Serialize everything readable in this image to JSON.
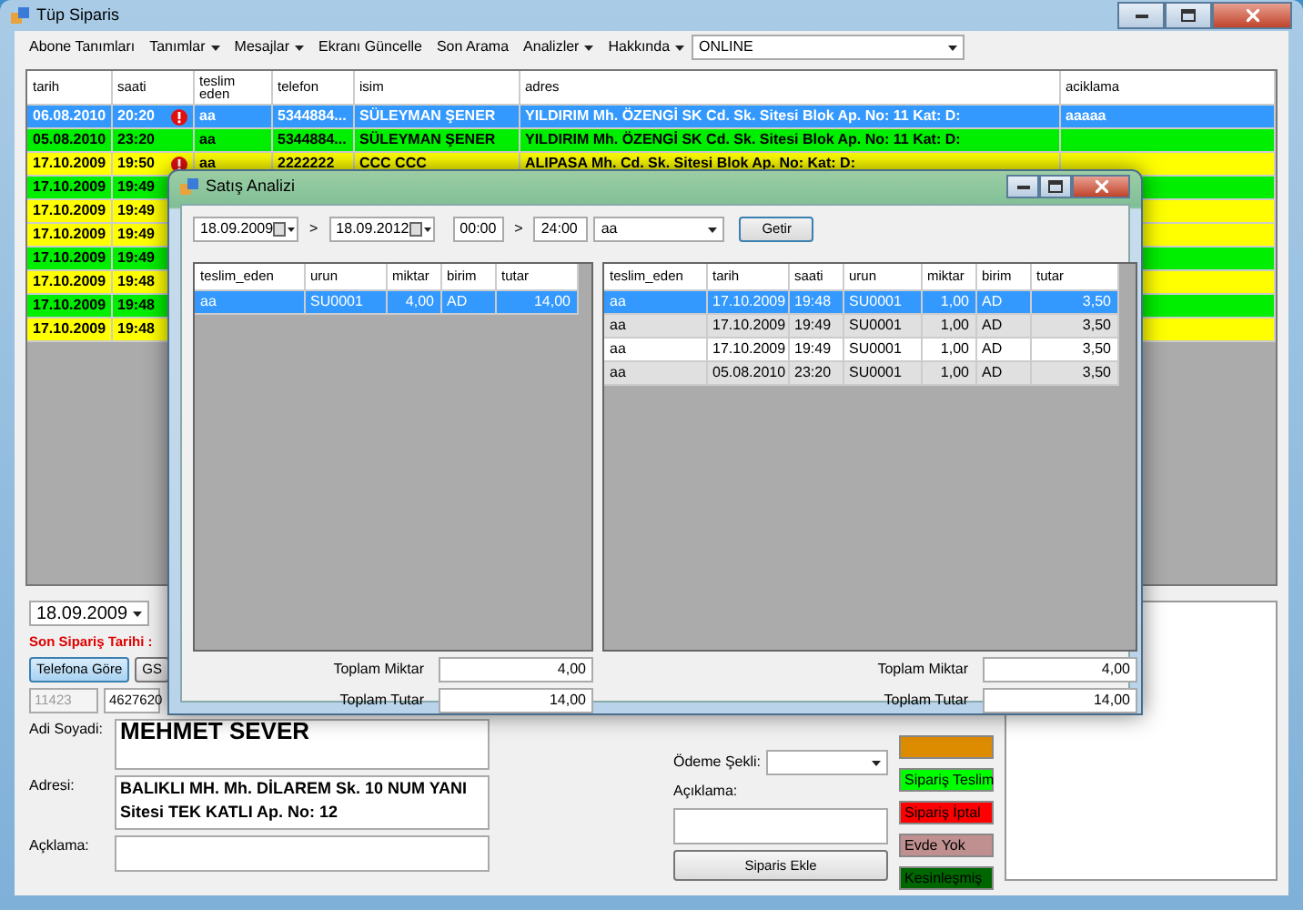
{
  "window": {
    "title": "Tüp Siparis"
  },
  "menu": [
    {
      "label": "Abone Tanımları",
      "dropdown": false
    },
    {
      "label": "Tanımlar",
      "dropdown": true
    },
    {
      "label": "Mesajlar",
      "dropdown": true
    },
    {
      "label": "Ekranı Güncelle",
      "dropdown": false
    },
    {
      "label": "Son Arama",
      "dropdown": false
    },
    {
      "label": "Analizler",
      "dropdown": true
    },
    {
      "label": "Hakkında",
      "dropdown": true
    }
  ],
  "status_combo": {
    "value": "ONLINE"
  },
  "orders": {
    "columns": [
      "tarih",
      "saati",
      "teslim eden",
      "telefon",
      "isim",
      "adres",
      "aciklama"
    ],
    "rows": [
      {
        "tarih": "06.08.2010",
        "saati": "20:20",
        "alert": true,
        "teslim_eden": "aa",
        "telefon": "5344884...",
        "isim": "SÜLEYMAN ŞENER",
        "adres": "YILDIRIM Mh. ÖZENGİ SK Cd.  Sk.  Sitesi  Blok  Ap. No: 11 Kat:  D:",
        "aciklama": "aaaaa",
        "selected": true
      },
      {
        "tarih": "05.08.2010",
        "saati": "23:20",
        "alert": false,
        "teslim_eden": "aa",
        "telefon": "5344884...",
        "isim": "SÜLEYMAN ŞENER",
        "adres": "YILDIRIM Mh. ÖZENGİ SK Cd.  Sk.  Sitesi  Blok  Ap. No: 11 Kat:  D:",
        "color": "#00ee00",
        "selected": false
      },
      {
        "tarih": "17.10.2009",
        "saati": "19:50",
        "alert": true,
        "teslim_eden": "aa",
        "telefon": "2222222",
        "isim": "CCC CCC",
        "adres": "ALIPASA Mh.  Cd.  Sk.  Sitesi  Blok  Ap. No:  Kat:  D:",
        "color": "#ffff00",
        "selected": false
      },
      {
        "tarih": "17.10.2009",
        "saati": "19:49",
        "color": "#00ee00",
        "selected": false
      },
      {
        "tarih": "17.10.2009",
        "saati": "19:49",
        "color": "#ffff00",
        "selected": false
      },
      {
        "tarih": "17.10.2009",
        "saati": "19:49",
        "color": "#ffff00",
        "selected": false
      },
      {
        "tarih": "17.10.2009",
        "saati": "19:49",
        "color": "#00ee00",
        "selected": false
      },
      {
        "tarih": "17.10.2009",
        "saati": "19:48",
        "color": "#ffff00",
        "selected": false
      },
      {
        "tarih": "17.10.2009",
        "saati": "19:48",
        "color": "#00ee00",
        "selected": false
      },
      {
        "tarih": "17.10.2009",
        "saati": "19:48",
        "color": "#ffff00",
        "selected": false
      }
    ]
  },
  "order_form": {
    "date": "18.09.2009",
    "last_order_label": "Son Sipariş Tarihi :",
    "search_buttons": [
      {
        "label": "Telefona Göre",
        "selected": true
      },
      {
        "label": "GS",
        "selected": false
      }
    ],
    "customer_no": {
      "value": "11423",
      "disabled": true
    },
    "phone": {
      "value": "4627620"
    },
    "name_label": "Adi Soyadi:",
    "name": "MEHMET SEVER",
    "address_label": "Adresi:",
    "address": "BALIKLI MH. Mh. DİLAREM Sk. 10 NUM YANI Sitesi TEK KATLI Ap. No: 12",
    "note_label": "Açklama:"
  },
  "payment": {
    "method_label": "Ödeme Şekli:",
    "note_label": "Açıklama:",
    "submit": "Siparis Ekle"
  },
  "legend": [
    {
      "color": "#dd8c00"
    },
    {
      "label": "Sipariş Teslim",
      "color": "#00ff00"
    },
    {
      "label": "Sipariş İptal",
      "color": "#ff0000"
    },
    {
      "label": "Evde Yok",
      "color": "#c09090"
    },
    {
      "label": "Kesinleşmiş",
      "color": "#006600"
    }
  ],
  "dialog": {
    "title": "Satış Analizi",
    "filter": {
      "from_date": "18.09.2009",
      "separator_1": ">",
      "to_date": "18.09.2012",
      "from_time": "00:00",
      "separator_2": ">",
      "to_time": "24:00",
      "person": "aa",
      "button": "Getir"
    },
    "left_grid": {
      "columns": [
        "teslim_eden",
        "urun",
        "miktar",
        "birim",
        "tutar"
      ],
      "rows": [
        {
          "cells": [
            "aa",
            "SU0001",
            "4,00",
            "AD",
            "14,00"
          ],
          "selected": true
        }
      ],
      "total_qty_label": "Toplam Miktar",
      "total_qty": "4,00",
      "total_sum_label": "Toplam Tutar",
      "total_sum": "14,00"
    },
    "right_grid": {
      "columns": [
        "teslim_eden",
        "tarih",
        "saati",
        "urun",
        "miktar",
        "birim",
        "tutar"
      ],
      "rows": [
        {
          "cells": [
            "aa",
            "17.10.2009",
            "19:48",
            "SU0001",
            "1,00",
            "AD",
            "3,50"
          ],
          "selected": true
        },
        {
          "cells": [
            "aa",
            "17.10.2009",
            "19:49",
            "SU0001",
            "1,00",
            "AD",
            "3,50"
          ],
          "selected": false
        },
        {
          "cells": [
            "aa",
            "17.10.2009",
            "19:49",
            "SU0001",
            "1,00",
            "AD",
            "3,50"
          ],
          "selected": false
        },
        {
          "cells": [
            "aa",
            "05.08.2010",
            "23:20",
            "SU0001",
            "1,00",
            "AD",
            "3,50"
          ],
          "selected": false
        }
      ],
      "total_qty_label": "Toplam Miktar",
      "total_qty": "4,00",
      "total_sum_label": "Toplam Tutar",
      "total_sum": "14,00"
    }
  }
}
